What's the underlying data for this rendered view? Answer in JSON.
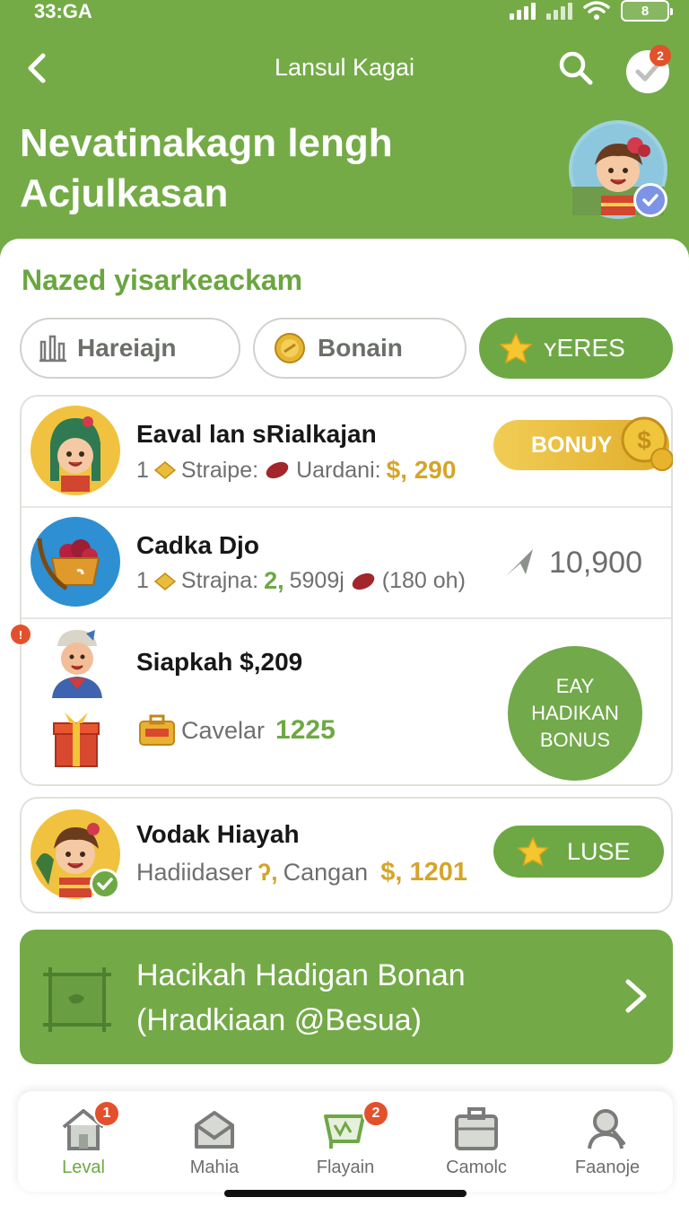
{
  "status_bar": {
    "time": "33:GA",
    "battery": "8"
  },
  "header": {
    "nav_title": "Lansul Kagai",
    "hero_title_line1": "Nevatinakagn lengh",
    "hero_title_line2": "Acjulkasan",
    "notification_count": "2",
    "brand_color": "#74ab47"
  },
  "section": {
    "title": "Nazed yisarkeackam"
  },
  "filters": [
    {
      "label": "Hareiajn",
      "icon": "trophy-icon",
      "active": false
    },
    {
      "label": "Bonain",
      "icon": "coin-icon",
      "active": false
    },
    {
      "label": "ʏERES",
      "icon": "star-icon",
      "active": true
    }
  ],
  "rows": [
    {
      "name": "Eaval lan sRialkajan",
      "meta_prefix": "1",
      "meta_label1": "Straipe:",
      "meta_label2": "Uardani:",
      "meta_value": "$, 290",
      "action_label": "BONUY"
    },
    {
      "name": "Cadka Djo",
      "meta_prefix": "1",
      "meta_label1": "Strajna:",
      "meta_value1": "2,",
      "meta_value1b": "5909j",
      "meta_value2": "(180 oh)",
      "value": "10,900"
    },
    {
      "name": "Siapkah $,209",
      "meta_label": "Cavelar",
      "meta_value": "1225",
      "alert_count": "!",
      "seal_line1": "EAY",
      "seal_line2": "HADIKAN",
      "seal_line3": "BONUS"
    }
  ],
  "featured": {
    "name": "Vodak Hiayah",
    "meta_label": "Hadiidaser",
    "meta_mid": "ʔ,",
    "meta_label2": "Cangan",
    "meta_value": "$, 1201",
    "action_label": "LUSE"
  },
  "cta": {
    "line1": "Hacikah Hadigan Bonan",
    "line2": "(Hradkiaan @Besua)"
  },
  "bottom_nav": [
    {
      "label": "Leval",
      "icon": "home-icon",
      "badge": "1",
      "active": true
    },
    {
      "label": "Mahia",
      "icon": "mail-icon",
      "badge": "",
      "active": false
    },
    {
      "label": "Flayain",
      "icon": "cart-icon",
      "badge": "2",
      "active": false
    },
    {
      "label": "Camolc",
      "icon": "briefcase-icon",
      "badge": "",
      "active": false
    },
    {
      "label": "Faanoje",
      "icon": "profile-icon",
      "badge": "",
      "active": false
    }
  ]
}
